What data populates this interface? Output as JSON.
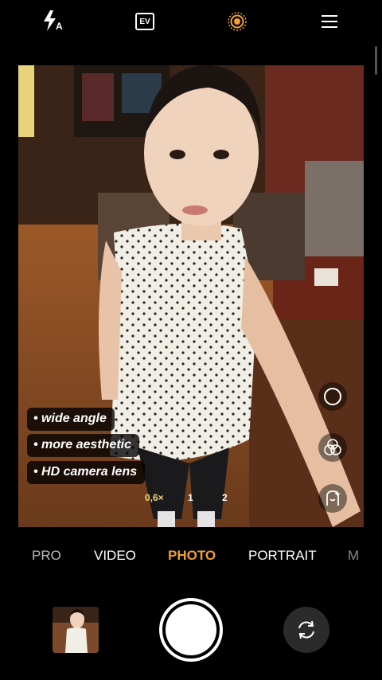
{
  "top_bar": {
    "flash_icon": "flash-auto-icon",
    "flash_badge": "A",
    "ev_label": "EV",
    "live_icon": "live-photo-icon",
    "menu_icon": "menu-icon"
  },
  "captions": [
    "• wide angle",
    "• more aesthetic",
    "• HD camera lens"
  ],
  "zoom": {
    "options": [
      "0,6×",
      "1",
      "2"
    ],
    "active_index": 0,
    "active_color": "#f2d27a"
  },
  "side_controls": [
    "shutter-mode-icon",
    "filter-icon",
    "beauty-icon"
  ],
  "modes": {
    "items": [
      "PRO",
      "VIDEO",
      "PHOTO",
      "PORTRAIT",
      "M"
    ],
    "active": "PHOTO",
    "active_color": "#f0a030"
  },
  "bottom": {
    "gallery": "gallery-thumbnail",
    "shutter": "shutter-button",
    "switch": "switch-camera-icon"
  }
}
